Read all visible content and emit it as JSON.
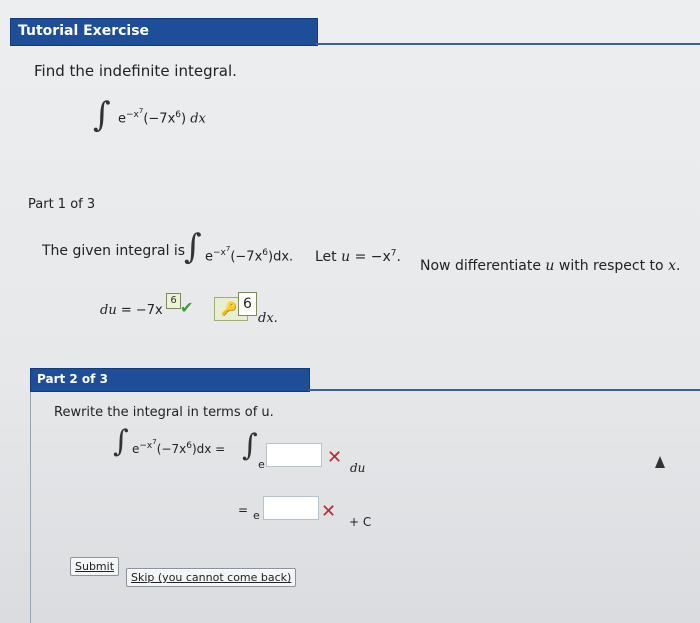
{
  "header": {
    "title": "Tutorial Exercise"
  },
  "prompt": "Find the indefinite integral.",
  "integral": {
    "integrand_base": "e",
    "exponent": "−x",
    "exponent_power": "7",
    "factor": "(−7x",
    "factor_power": "6",
    "factor_close": ")",
    "dx": "dx"
  },
  "part1": {
    "label": "Part 1 of 3",
    "sentence_start": "The given integral is",
    "integral_text_dx": ")dx.",
    "let_text": "Let",
    "u": "u",
    "equals_minus_x": "= −x",
    "power7": "7",
    "period": ".",
    "now_text": "Now differentiate",
    "respect_text": "with respect to",
    "x": "x",
    "du_eq": "du",
    "eq_minus": "= −7x",
    "answer_exp": "6",
    "answer_box": "6",
    "dx_word": "dx."
  },
  "part2": {
    "label": "Part 2 of 3",
    "instruction": "Rewrite the integral in terms of u.",
    "lhs_close": ")dx =",
    "e": "e",
    "du": "du",
    "eq": "=",
    "plus_c": "+ C"
  },
  "buttons": {
    "submit": "Submit",
    "skip": "Skip (you cannot come back)"
  },
  "colors": {
    "header_bg": "#1f4e98",
    "check": "#3b9c3a",
    "x_mark": "#c0282a"
  }
}
